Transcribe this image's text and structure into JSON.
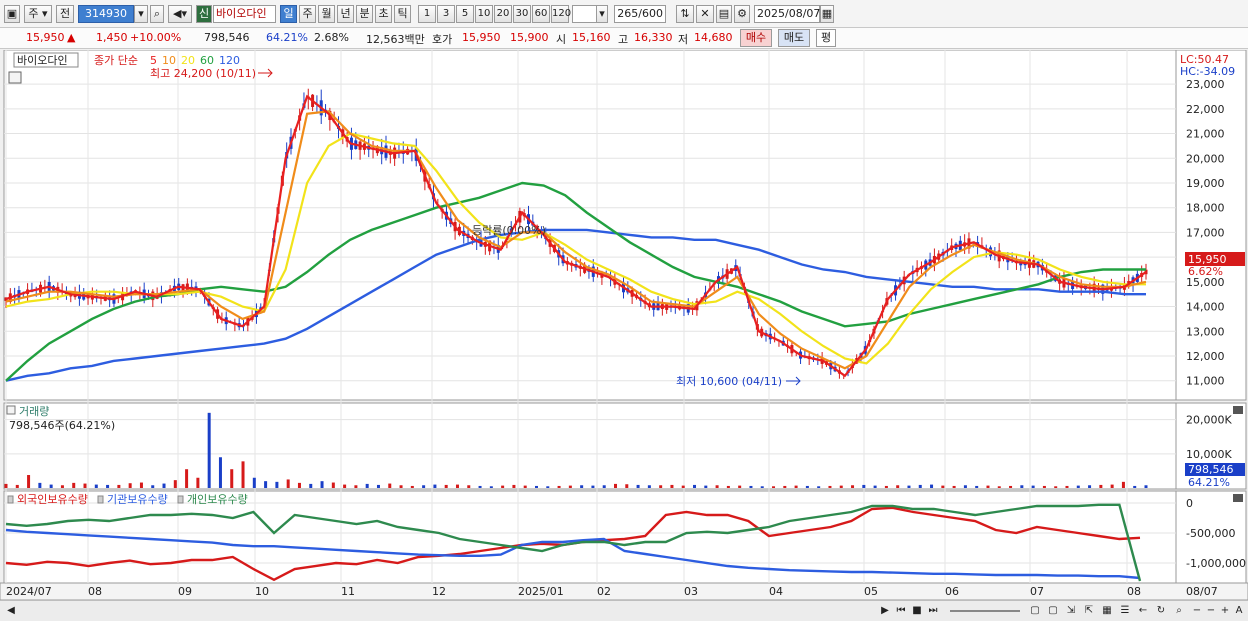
{
  "toolbar": {
    "market_label": "주",
    "prev_label": "전",
    "stock_code": "314930",
    "new_badge": "신",
    "stock_name": "바이오다인",
    "periods": [
      "일",
      "주",
      "월",
      "년",
      "분",
      "초",
      "틱"
    ],
    "active_period": "일",
    "intervals": [
      "1",
      "3",
      "5",
      "10",
      "20",
      "30",
      "60",
      "120"
    ],
    "count_value": "265",
    "count_total": "/600",
    "date_value": "2025/08/07"
  },
  "quote": {
    "price": "15,950",
    "change": "1,450",
    "change_pct": "+10.00%",
    "volume": "798,546",
    "volume_ratio": "64.21%",
    "turnover_rate": "2.68%",
    "amount": "12,563백만",
    "ask_label": "호가",
    "ask1": "15,950",
    "ask2": "15,900",
    "open_label": "시",
    "open": "15,160",
    "high_label": "고",
    "high": "16,330",
    "low_label": "저",
    "low": "14,680",
    "buy_label": "매수",
    "sell_label": "매도",
    "avg_label": "평"
  },
  "price_panel": {
    "title": "바이오다인",
    "ma_label": "종가 단순",
    "ma_periods": [
      "5",
      "10",
      "20",
      "60",
      "120"
    ],
    "ma_colors": [
      "#e82020",
      "#f08c1a",
      "#f2e31a",
      "#22a040",
      "#2d5de0"
    ],
    "lc_label": "LC:50.47",
    "hc_label": "HC:-34.09",
    "high_annotation": "최고 24,200 (10/11)",
    "low_annotation": "최저 10,600 (04/11)",
    "mid_annotation": "등락률(0.00%)",
    "current_tag": "15,950",
    "current_pct": "6.62%"
  },
  "volume_panel": {
    "title": "거래량",
    "value_label": "798,546주(64.21%)",
    "current_tag": "798,546",
    "current_pct": "64.21%"
  },
  "holding_panel": {
    "labels": [
      "외국인보유수량",
      "기관보유수량",
      "개인보유수량"
    ],
    "label_colors": [
      "#d61a1a",
      "#2d5de0",
      "#2e8a4e"
    ]
  },
  "chart_data": [
    {
      "type": "line",
      "title": "바이오다인",
      "x_ticks": [
        "2024/07",
        "08",
        "09",
        "10",
        "11",
        "12",
        "2025/01",
        "02",
        "03",
        "04",
        "05",
        "06",
        "07",
        "08",
        "08/07"
      ],
      "y_ticks": [
        11000,
        12000,
        13000,
        14000,
        15000,
        16000,
        17000,
        18000,
        19000,
        20000,
        21000,
        22000,
        23000
      ],
      "y_tick_labels": [
        "11,000",
        "12,000",
        "13,000",
        "14,000",
        "15,000",
        "16,000",
        "17,000",
        "18,000",
        "19,000",
        "20,000",
        "21,000",
        "22,000",
        "23,000"
      ],
      "ylim": [
        10300,
        24300
      ],
      "series": [
        {
          "name": "5",
          "values": [
            14300,
            14600,
            14800,
            14500,
            14400,
            14300,
            14600,
            14400,
            14800,
            14700,
            13500,
            13200,
            14000,
            20000,
            22500,
            21800,
            20600,
            20400,
            20200,
            20300,
            18200,
            17100,
            16600,
            16300,
            17800,
            16900,
            15800,
            15500,
            15200,
            14600,
            14000,
            14000,
            13900,
            15000,
            15600,
            13000,
            12600,
            12000,
            11800,
            11200,
            12300,
            14300,
            15300,
            15800,
            16400,
            16600,
            16100,
            15800,
            15700,
            15000,
            14800,
            14700,
            14800,
            15400
          ]
        },
        {
          "name": "10",
          "values": [
            14200,
            14400,
            14600,
            14600,
            14500,
            14400,
            14500,
            14500,
            14600,
            14700,
            14000,
            13500,
            13800,
            17800,
            21800,
            21900,
            21000,
            20500,
            20300,
            20300,
            18800,
            17500,
            16800,
            16400,
            17000,
            17000,
            16200,
            15600,
            15300,
            14800,
            14200,
            14100,
            14000,
            14600,
            15200,
            13700,
            12900,
            12300,
            11900,
            11500,
            12000,
            13400,
            14800,
            15600,
            16100,
            16500,
            16200,
            15900,
            15700,
            15200,
            14900,
            14800,
            14800,
            15000
          ]
        },
        {
          "name": "20",
          "values": [
            14000,
            14200,
            14300,
            14500,
            14600,
            14600,
            14500,
            14500,
            14500,
            14600,
            14400,
            14000,
            13800,
            15500,
            19000,
            20500,
            21000,
            20800,
            20600,
            20500,
            19500,
            18300,
            17400,
            16800,
            16700,
            17000,
            16500,
            15900,
            15500,
            15100,
            14600,
            14300,
            14100,
            14200,
            14600,
            14300,
            13700,
            13000,
            12400,
            11900,
            11700,
            12500,
            13700,
            14700,
            15400,
            16000,
            16200,
            16100,
            15900,
            15500,
            15200,
            15000,
            14900,
            14900
          ]
        },
        {
          "name": "60",
          "values": [
            11000,
            11800,
            12500,
            13000,
            13500,
            13900,
            14200,
            14400,
            14500,
            14700,
            14800,
            14700,
            14600,
            14800,
            15400,
            16100,
            16700,
            17100,
            17400,
            17700,
            18000,
            18200,
            18400,
            18700,
            19000,
            18900,
            18500,
            17800,
            17200,
            16600,
            16100,
            15600,
            15200,
            15000,
            14800,
            14500,
            14200,
            13800,
            13500,
            13200,
            13300,
            13400,
            13700,
            13900,
            14100,
            14300,
            14500,
            14700,
            14900,
            15200,
            15400,
            15500,
            15500,
            15500
          ]
        },
        {
          "name": "120",
          "values": [
            11000,
            11200,
            11300,
            11500,
            11600,
            11800,
            11900,
            12000,
            12100,
            12200,
            12300,
            12400,
            12500,
            12700,
            13100,
            13600,
            14100,
            14600,
            15100,
            15600,
            16100,
            16400,
            16700,
            16900,
            17000,
            17100,
            17100,
            17100,
            17000,
            16900,
            16800,
            16800,
            16700,
            16700,
            16500,
            16300,
            16000,
            15700,
            15500,
            15400,
            15200,
            15100,
            15000,
            14900,
            14800,
            14800,
            14700,
            14700,
            14700,
            14600,
            14600,
            14600,
            14500,
            14500
          ]
        }
      ]
    },
    {
      "type": "bar",
      "title": "거래량",
      "y_ticks": [
        10000000,
        20000000
      ],
      "y_tick_labels": [
        "10,000K",
        "20,000K"
      ],
      "ylim": [
        0,
        24000000
      ],
      "values": [
        1200000,
        900000,
        3800000,
        1500000,
        1000000,
        800000,
        1500000,
        1300000,
        1000000,
        900000,
        900000,
        1400000,
        1600000,
        800000,
        1300000,
        2300000,
        5500000,
        3000000,
        22000000,
        9000000,
        5500000,
        7800000,
        3000000,
        2000000,
        1800000,
        2500000,
        1500000,
        1200000,
        2000000,
        1600000,
        1000000,
        800000,
        1200000,
        900000,
        1300000,
        800000,
        600000,
        800000,
        1000000,
        900000,
        1000000,
        800000,
        600000,
        500000,
        700000,
        900000,
        700000,
        600000,
        500000,
        600000,
        700000,
        800000,
        700000,
        800000,
        1200000,
        1100000,
        900000,
        800000,
        800000,
        900000,
        700000,
        900000,
        700000,
        800000,
        600000,
        700000,
        600000,
        500000,
        500000,
        600000,
        700000,
        600000,
        500000,
        600000,
        700000,
        800000,
        900000,
        700000,
        600000,
        800000,
        700000,
        900000,
        1000000,
        700000,
        600000,
        800000,
        600000,
        700000,
        500000,
        600000,
        800000,
        700000,
        600000,
        500000,
        600000,
        700000,
        800000,
        900000,
        1000000,
        1800000,
        600000,
        798546
      ]
    },
    {
      "type": "line",
      "title": "외국인보유수량 · 기관보유수량 · 개인보유수량",
      "y_ticks": [
        0,
        -500000,
        -1000000
      ],
      "y_tick_labels": [
        "0",
        "-500,000",
        "-1,000,000"
      ],
      "ylim": [
        -1300000,
        150000
      ],
      "series": [
        {
          "name": "외국인보유수량",
          "values": [
            -1000000,
            -1030000,
            -980000,
            -1000000,
            -1050000,
            -1000000,
            -960000,
            -1020000,
            -1000000,
            -950000,
            -950000,
            -900000,
            -1100000,
            -1280000,
            -1100000,
            -1050000,
            -1000000,
            -1020000,
            -950000,
            -1000000,
            -900000,
            -880000,
            -850000,
            -800000,
            -750000,
            -700000,
            -680000,
            -700000,
            -650000,
            -620000,
            -600000,
            -550000,
            -200000,
            -150000,
            -200000,
            -200000,
            -300000,
            -550000,
            -500000,
            -450000,
            -400000,
            -300000,
            -100000,
            -80000,
            -150000,
            -200000,
            -250000,
            -300000,
            -450000,
            -500000,
            -400000,
            -450000,
            -500000,
            -550000,
            -600000,
            -580000
          ]
        },
        {
          "name": "기관보유수량",
          "values": [
            -450000,
            -480000,
            -500000,
            -520000,
            -540000,
            -560000,
            -580000,
            -600000,
            -620000,
            -640000,
            -660000,
            -700000,
            -720000,
            -720000,
            -740000,
            -760000,
            -780000,
            -800000,
            -820000,
            -840000,
            -860000,
            -870000,
            -880000,
            -880000,
            -860000,
            -700000,
            -650000,
            -650000,
            -620000,
            -600000,
            -800000,
            -850000,
            -900000,
            -950000,
            -1000000,
            -1050000,
            -1080000,
            -1100000,
            -1120000,
            -1130000,
            -1140000,
            -1150000,
            -1150000,
            -1160000,
            -1170000,
            -1180000,
            -1180000,
            -1190000,
            -1200000,
            -1200000,
            -1200000,
            -1210000,
            -1210000,
            -1220000,
            -1220000,
            -1250000
          ]
        },
        {
          "name": "개인보유수량",
          "values": [
            -350000,
            -380000,
            -350000,
            -300000,
            -280000,
            -300000,
            -250000,
            -200000,
            -200000,
            -180000,
            -200000,
            -250000,
            -150000,
            -500000,
            -200000,
            -250000,
            -300000,
            -350000,
            -300000,
            -400000,
            -450000,
            -500000,
            -600000,
            -650000,
            -700000,
            -750000,
            -800000,
            -700000,
            -650000,
            -650000,
            -700000,
            -650000,
            -650000,
            -500000,
            -480000,
            -500000,
            -450000,
            -400000,
            -300000,
            -250000,
            -200000,
            -150000,
            -50000,
            -50000,
            -100000,
            -100000,
            -150000,
            -200000,
            -150000,
            -100000,
            -50000,
            -50000,
            -50000,
            -30000,
            -30000,
            -1300000
          ]
        }
      ]
    }
  ]
}
